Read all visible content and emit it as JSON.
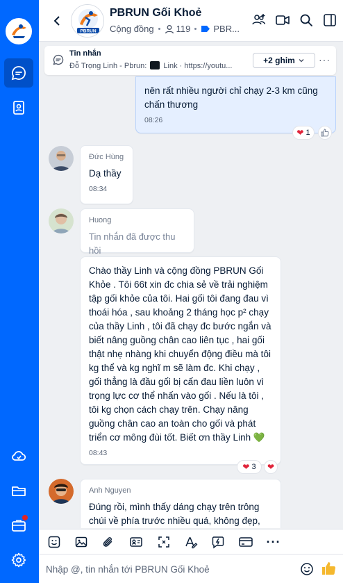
{
  "header": {
    "title": "PBRUN Gối Khoẻ",
    "type_label": "Cộng đồng",
    "member_count": "119",
    "tag_label": "PBR..."
  },
  "pinned": {
    "title": "Tin nhắn",
    "preview_prefix": "Đỗ Trọng Linh - Pbrun:",
    "preview_suffix": "Link · https://youtu...",
    "more_label": "+2 ghim"
  },
  "messages": [
    {
      "sender": "",
      "mine": true,
      "text": "nên rất nhiều người chỉ chạy 2-3 km cũng chấn thương",
      "time": "08:26",
      "reaction_count": "1"
    },
    {
      "sender": "Đức Hùng",
      "text": "Dạ thầy",
      "time": "08:34"
    },
    {
      "sender": "Huong",
      "text": "Tin nhắn đã được thu hồi",
      "recalled": true
    },
    {
      "sender": "",
      "text": "Chào thầy Linh và cộng đồng PBRUN Gối Khỏe . Tôi 66t  xin đc chia sẻ về trải nghiệm tập gối khỏe của tôi. Hai gối tôi đang đau vì thoái hóa , sau khoảng 2 tháng học p² chạy của thầy Linh ,  tôi đã chạy đc bước ngắn và biết nâng guồng chân cao liên tục , hai gối thật nhẹ nhàng khi chuyển động điều mà tôi kg thể và kg nghĩ m sẽ làm đc. Khi chạy , gối thẳng là đầu gối bị cấn đau liền luôn vì trọng lực cơ thể nhấn vào gối . Nếu là tôi , tôi kg chọn cách chạy trên. Chạy nâng guồng chân cao an toàn cho gối và phát triển cơ mông đùi tốt. Biết ơn thầy Linh 💚",
      "time": "08:43",
      "reaction_count": "3"
    },
    {
      "sender": "Anh Nguyen",
      "text": "Đúng rồi, mình thấy dáng chạy trên trông chúi về phía trước nhiều quá, không đẹp,"
    }
  ],
  "composer": {
    "placeholder": "Nhập @, tin nhắn tới PBRUN Gối Khoẻ"
  },
  "colors": {
    "brand": "#0068ff",
    "mine_bubble": "#e5efff",
    "heart": "#e0243a"
  }
}
